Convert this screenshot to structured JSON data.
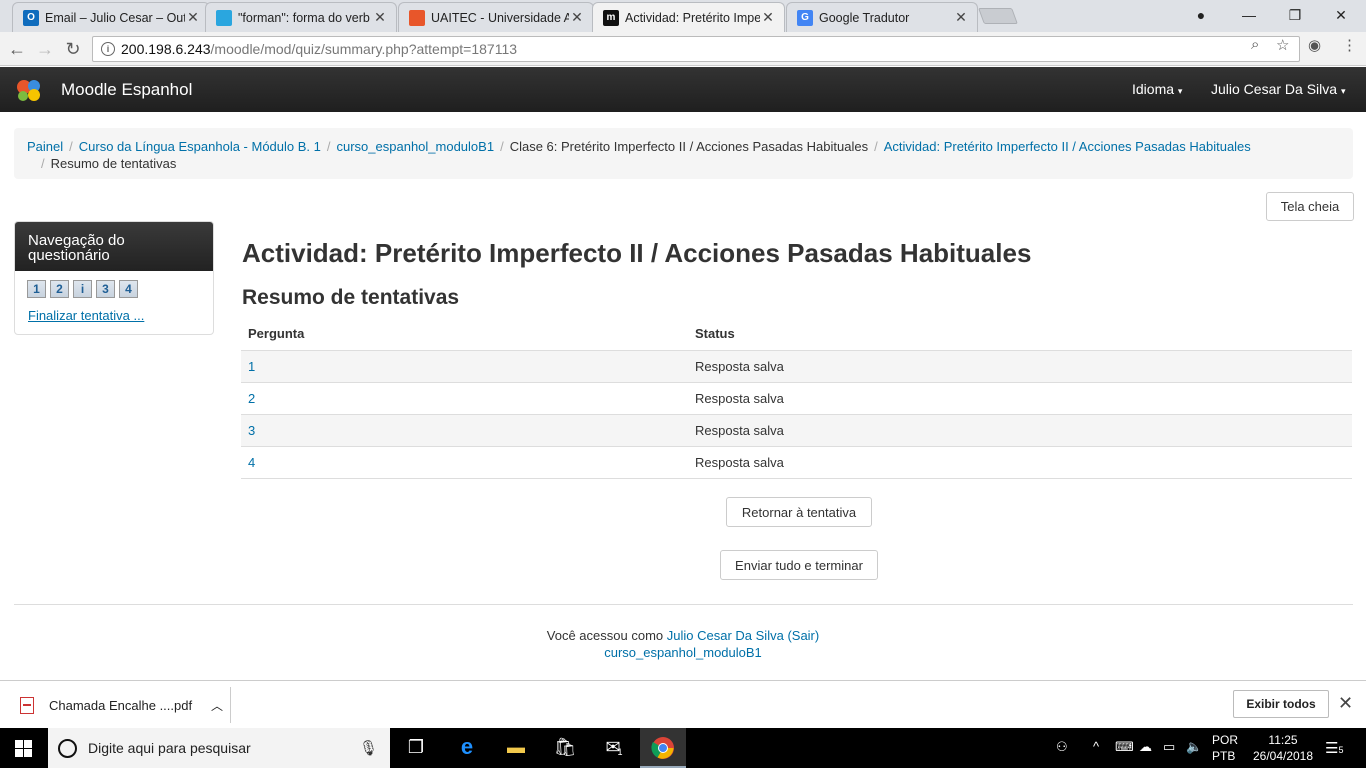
{
  "browser": {
    "tabs": [
      {
        "title": "Email – Julio Cesar – Out",
        "favicon": "outlook-icon",
        "color": "#0f6cbd"
      },
      {
        "title": "\"forman\": forma do verb",
        "favicon": "priberam-icon",
        "color": "#2aa6df"
      },
      {
        "title": "UAITEC - Universidade Ab",
        "favicon": "uaitec-icon",
        "color": "#e8562a"
      },
      {
        "title": "Actividad: Pretérito Impe",
        "favicon": "moodle-icon",
        "color": "#111111"
      },
      {
        "title": "Google Tradutor",
        "favicon": "google-translate-icon",
        "color": "#4285f4"
      }
    ],
    "url_host": "200.198.6.243",
    "url_path": "/moodle/mod/quiz/summary.php?attempt=187113"
  },
  "moodle": {
    "brand": "Moodle Espanhol",
    "menu_language": "Idioma",
    "menu_user": "Julio Cesar Da Silva"
  },
  "breadcrumb": [
    {
      "label": "Painel",
      "link": true
    },
    {
      "label": "Curso da Língua Espanhola - Módulo B. 1",
      "link": true
    },
    {
      "label": "curso_espanhol_moduloB1",
      "link": true
    },
    {
      "label": "Clase 6: Pretérito Imperfecto II / Acciones Pasadas Habituales",
      "link": false
    },
    {
      "label": "Actividad: Pretérito Imperfecto II / Acciones Pasadas Habituales",
      "link": true
    },
    {
      "label": "Resumo de tentativas",
      "link": false
    }
  ],
  "fullscreen_label": "Tela cheia",
  "quiz_nav": {
    "title": "Navegação do questionário",
    "buttons": [
      "1",
      "2",
      "i",
      "3",
      "4"
    ],
    "finish_link": "Finalizar tentativa ..."
  },
  "main": {
    "title": "Actividad: Pretérito Imperfecto II / Acciones Pasadas Habituales",
    "subtitle": "Resumo de tentativas",
    "col_question": "Pergunta",
    "col_status": "Status",
    "rows": [
      {
        "question": "1",
        "status": "Resposta salva"
      },
      {
        "question": "2",
        "status": "Resposta salva"
      },
      {
        "question": "3",
        "status": "Resposta salva"
      },
      {
        "question": "4",
        "status": "Resposta salva"
      }
    ],
    "return_button": "Retornar à tentativa",
    "submit_button": "Enviar tudo e terminar"
  },
  "footer": {
    "logged_prefix": "Você acessou como",
    "user": "Julio Cesar Da Silva",
    "logout": "(Sair)",
    "course": "curso_espanhol_moduloB1"
  },
  "downloads": {
    "file": "Chamada Encalhe ....pdf",
    "show_all": "Exibir todos"
  },
  "taskbar": {
    "search_placeholder": "Digite aqui para pesquisar",
    "lang_top": "POR",
    "lang_bottom": "PTB",
    "time": "11:25",
    "date": "26/04/2018",
    "mail_badge": "1",
    "notif_badge": "5"
  }
}
